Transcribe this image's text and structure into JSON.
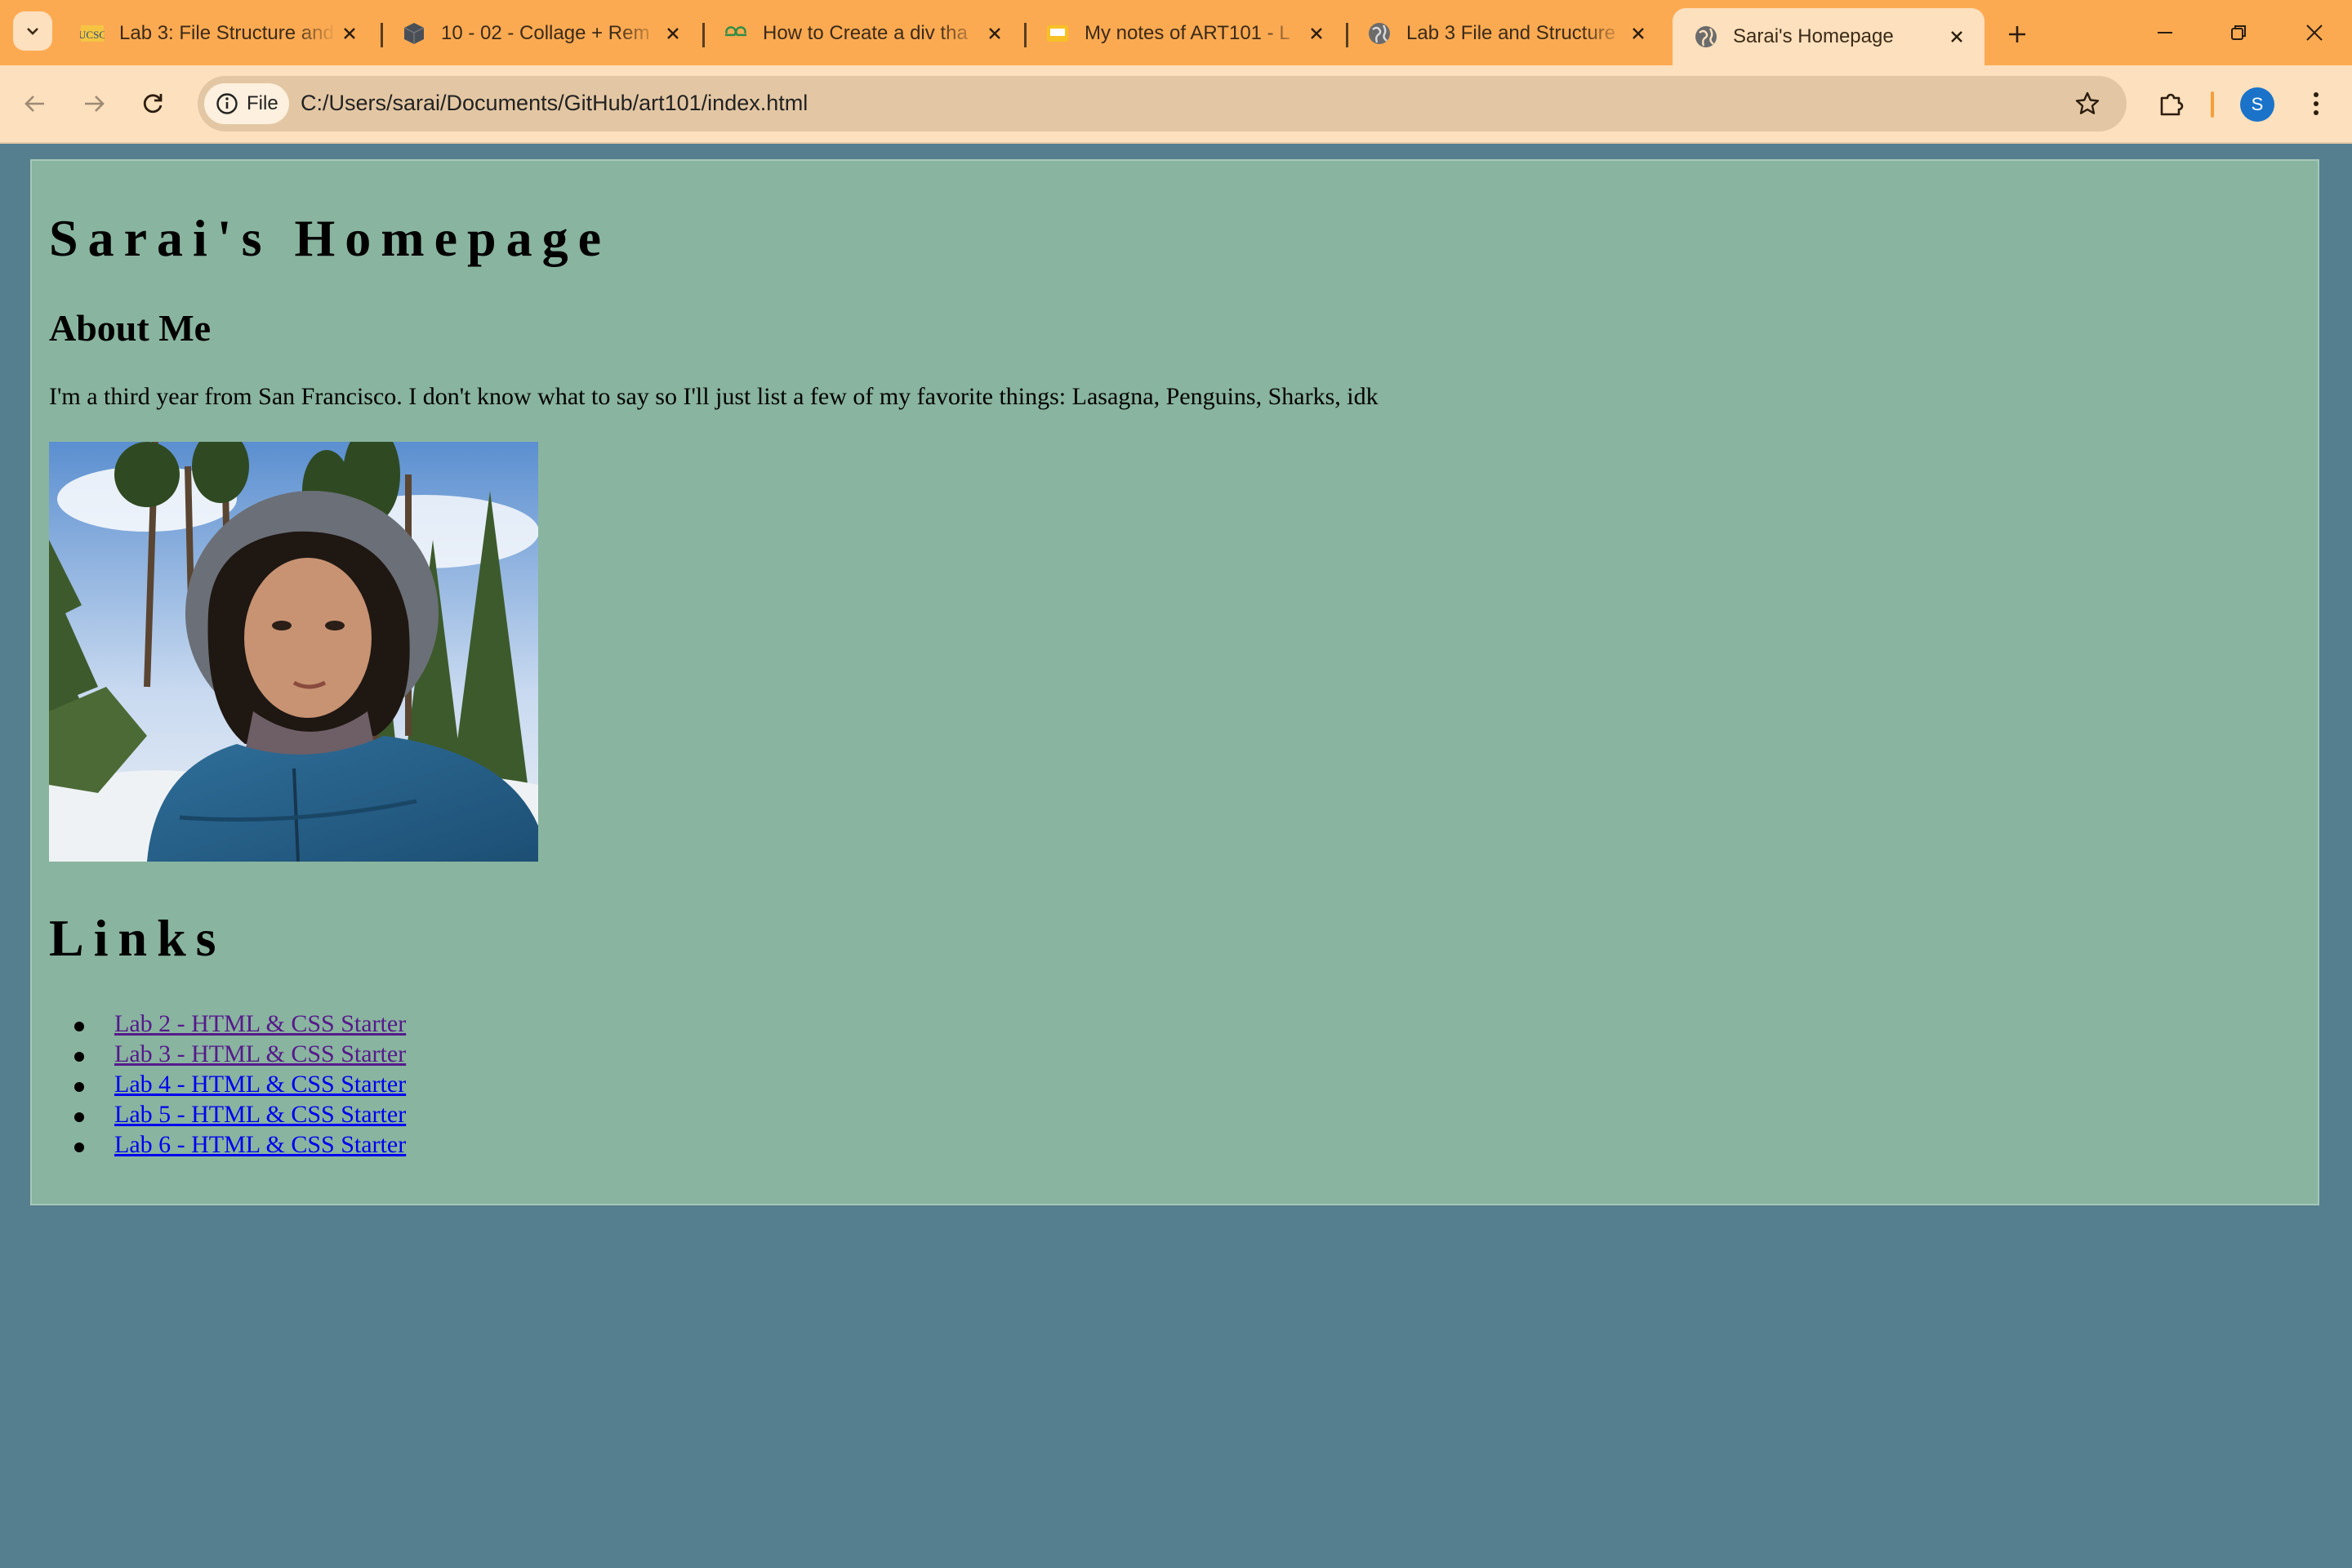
{
  "browser": {
    "tabs": [
      {
        "title": "Lab 3: File Structure and",
        "favicon": "ucsc-favicon",
        "active": false
      },
      {
        "title": "10 - 02 - Collage + Rem",
        "favicon": "cube-favicon",
        "active": false
      },
      {
        "title": "How to Create a div tha",
        "favicon": "geeksforgeeks-favicon",
        "active": false
      },
      {
        "title": "My notes of ART101 - L",
        "favicon": "notes-favicon",
        "active": false
      },
      {
        "title": "Lab 3 File and Structure",
        "favicon": "globe-favicon",
        "active": false
      },
      {
        "title": "Sarai's Homepage",
        "favicon": "globe-favicon",
        "active": true
      }
    ],
    "address_bar": {
      "scheme_chip": "File",
      "url": "C:/Users/sarai/Documents/GitHub/art101/index.html"
    },
    "profile_initial": "S",
    "colors": {
      "tabstrip": "#fcaa52",
      "toolbar": "#fde0bd",
      "avatar": "#1a73c9"
    }
  },
  "page": {
    "title": "Sarai's Homepage",
    "about_heading": "About Me",
    "about_text": "I'm a third year from San Francisco. I don't know what to say so I'll just list a few of my favorite things: Lasagna, Penguins, Sharks, idk",
    "links_heading": "Links",
    "links": [
      {
        "label": "Lab 2 - HTML & CSS Starter",
        "visited": true
      },
      {
        "label": "Lab 3 - HTML & CSS Starter",
        "visited": true
      },
      {
        "label": "Lab 4 - HTML & CSS Starter",
        "visited": false
      },
      {
        "label": "Lab 5 - HTML & CSS Starter",
        "visited": false
      },
      {
        "label": "Lab 6 - HTML & CSS Starter",
        "visited": false
      }
    ],
    "colors": {
      "background": "#557f8e",
      "container": "#89b49f"
    }
  }
}
